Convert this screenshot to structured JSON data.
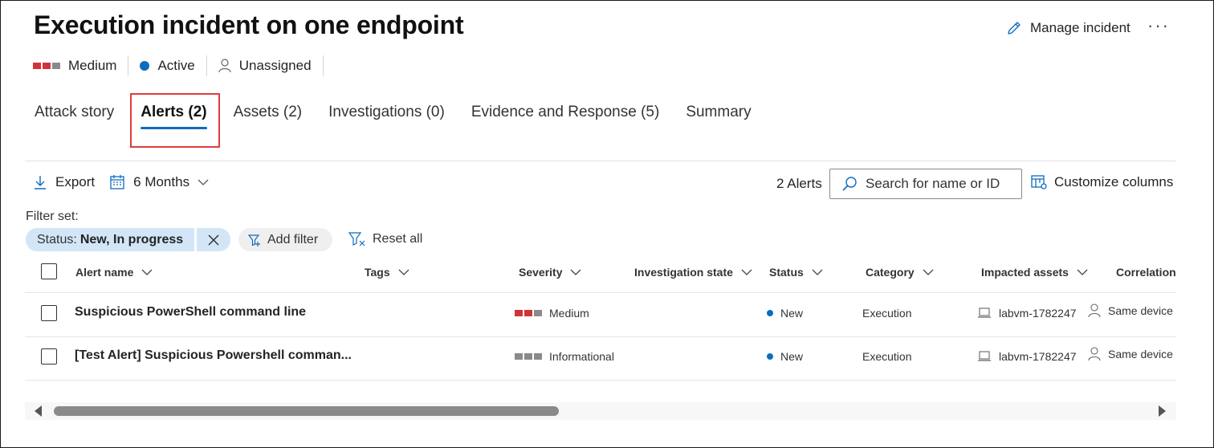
{
  "incident": {
    "title": "Execution incident on one endpoint",
    "manage_label": "Manage incident",
    "more_label": "···",
    "severity": "Medium",
    "status": "Active",
    "assignee": "Unassigned"
  },
  "tabs": [
    {
      "label": "Attack story",
      "active": false
    },
    {
      "label": "Alerts (2)",
      "active": true
    },
    {
      "label": "Assets (2)",
      "active": false
    },
    {
      "label": "Investigations (0)",
      "active": false
    },
    {
      "label": "Evidence and Response (5)",
      "active": false
    },
    {
      "label": "Summary",
      "active": false
    }
  ],
  "toolbar": {
    "export_label": "Export",
    "range_label": "6 Months",
    "alert_count": "2 Alerts",
    "search_placeholder": "Search for name or ID",
    "customize_label": "Customize columns"
  },
  "filters": {
    "set_label": "Filter set:",
    "chip_key": "Status:",
    "chip_value": "New, In progress",
    "add_filter_label": "Add filter",
    "reset_label": "Reset all"
  },
  "table": {
    "columns": [
      "Alert name",
      "Tags",
      "Severity",
      "Investigation state",
      "Status",
      "Category",
      "Impacted assets",
      "Correlation"
    ],
    "rows": [
      {
        "name": "Suspicious PowerShell command line",
        "severity": "Medium",
        "status": "New",
        "category": "Execution",
        "asset": "labvm-1782247",
        "correlation": "Same device"
      },
      {
        "name": "[Test Alert] Suspicious Powershell comman...",
        "severity": "Informational",
        "status": "New",
        "category": "Execution",
        "asset": "labvm-1782247",
        "correlation": "Same device"
      }
    ]
  },
  "colors": {
    "severity_red": "#d13438",
    "severity_gray": "#8a8a8a",
    "accent_blue": "#0f6cbd",
    "highlight_red": "#e03c3c"
  }
}
